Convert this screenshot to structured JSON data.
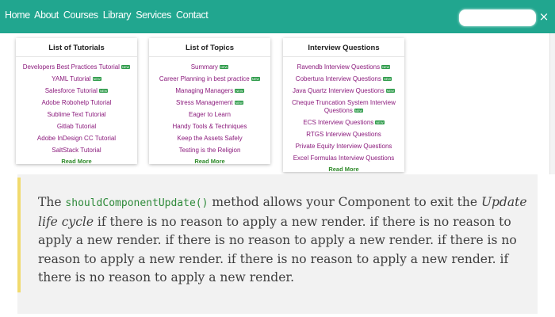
{
  "nav": {
    "links": [
      "Home",
      "About",
      "Courses",
      "Library",
      "Services",
      "Contact"
    ],
    "search_placeholder": "",
    "close_symbol": "×"
  },
  "colors": {
    "topbar": "#21a68f",
    "link": "#8b1a7c",
    "read_more": "#2f8a2a",
    "new_badge": "#2e9b4a",
    "quote_bar": "#f1da6e",
    "code": "#2e8a3a"
  },
  "cards": [
    {
      "title": "List of Tutorials",
      "items": [
        {
          "label": "Developers Best Practices Tutorial",
          "new": true
        },
        {
          "label": "YAML Tutorial",
          "new": true
        },
        {
          "label": "Salesforce Tutorial",
          "new": true
        },
        {
          "label": "Adobe Robohelp Tutorial",
          "new": false
        },
        {
          "label": "Sublime Text Tutorial",
          "new": false
        },
        {
          "label": "Gitlab Tutorial",
          "new": false
        },
        {
          "label": "Adobe InDesign CC Tutorial",
          "new": false
        },
        {
          "label": "SaltStack Tutorial",
          "new": false
        }
      ],
      "read_more": "Read More"
    },
    {
      "title": "List of Topics",
      "items": [
        {
          "label": "Summary",
          "new": true
        },
        {
          "label": "Career Planning in best practice",
          "new": true
        },
        {
          "label": "Managing Managers",
          "new": true
        },
        {
          "label": "Stress Management",
          "new": true
        },
        {
          "label": "Eager to Learn",
          "new": false
        },
        {
          "label": "Handy Tools & Techniques",
          "new": false
        },
        {
          "label": "Keep the Assets Safely",
          "new": false
        },
        {
          "label": "Testing is the Religion",
          "new": false
        }
      ],
      "read_more": "Read More"
    },
    {
      "title": "Interview Questions",
      "items": [
        {
          "label": "Ravendb Interview Questions",
          "new": true
        },
        {
          "label": "Cobertura Interview Questions",
          "new": true
        },
        {
          "label": "Java Quartz Interview Questions",
          "new": true
        },
        {
          "label": "Cheque Truncation System Interview Questions",
          "new": true
        },
        {
          "label": "ECS Interview Questions",
          "new": true
        },
        {
          "label": "RTGS Interview Questions",
          "new": false
        },
        {
          "label": "Private Equity Interview Questions",
          "new": false
        },
        {
          "label": "Excel Formulas Interview Questions",
          "new": false
        }
      ],
      "read_more": "Read More"
    }
  ],
  "badge_text": "NEW",
  "content": {
    "part1": "The ",
    "code": "shouldComponentUpdate()",
    "part2": " method allows your Component to exit the ",
    "emphasis": "Update life cycle",
    "part3": " if there is no reason to apply a new render. if there is no reason to apply a new render. if there is no reason to apply a new render. if there is no reason to apply a new render. if there is no reason to apply a new render. if there is no reason to apply a new render."
  }
}
